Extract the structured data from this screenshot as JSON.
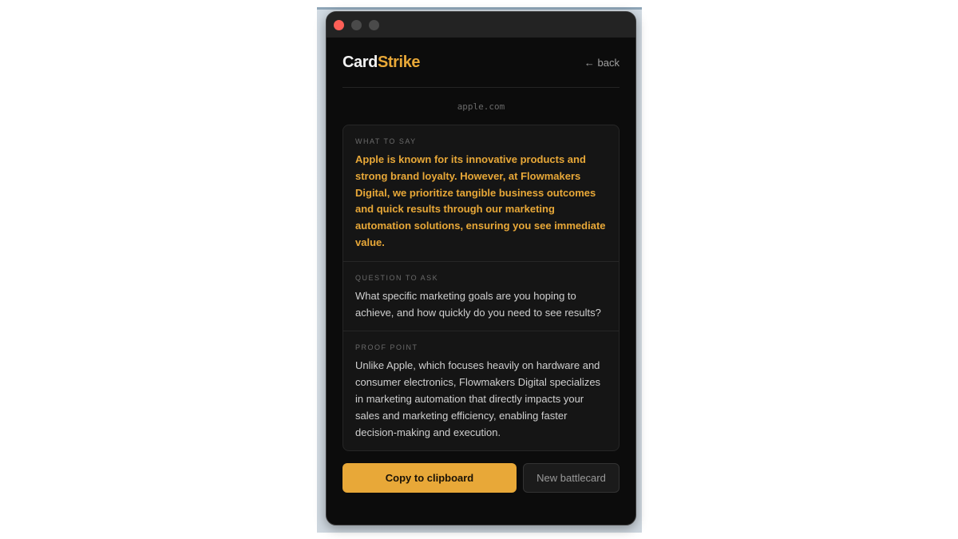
{
  "app": {
    "logo_part1": "Card",
    "logo_part2": "Strike",
    "back_label": "← back"
  },
  "domain": "apple.com",
  "battlecard": {
    "what_to_say": {
      "label": "WHAT TO SAY",
      "text": "Apple is known for its innovative products and strong brand loyalty. However, at Flowmakers Digital, we prioritize tangible business outcomes and quick results through our marketing automation solutions, ensuring you see immediate value."
    },
    "question_to_ask": {
      "label": "QUESTION TO ASK",
      "text": "What specific marketing goals are you hoping to achieve, and how quickly do you need to see results?"
    },
    "proof_point": {
      "label": "PROOF POINT",
      "text": "Unlike Apple, which focuses heavily on hardware and consumer electronics, Flowmakers Digital specializes in marketing automation that directly impacts your sales and marketing efficiency, enabling faster decision-making and execution."
    }
  },
  "actions": {
    "copy_label": "Copy to clipboard",
    "new_label": "New battlecard"
  },
  "colors": {
    "accent": "#e8a838",
    "background": "#0c0c0c",
    "card": "#151515",
    "close_dot": "#fe5f57"
  }
}
